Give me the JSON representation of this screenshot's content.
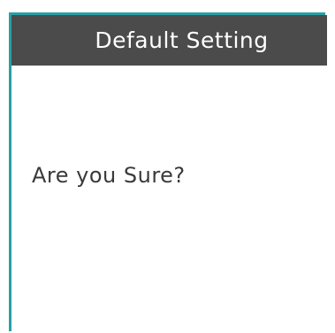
{
  "dialog": {
    "title": "Default Setting",
    "message": "Are you Sure?"
  },
  "colors": {
    "header_background": "#4b4b4b",
    "header_text": "#ffffff",
    "border_accent": "#2a9fa6",
    "message_text": "#3a3a3a"
  }
}
